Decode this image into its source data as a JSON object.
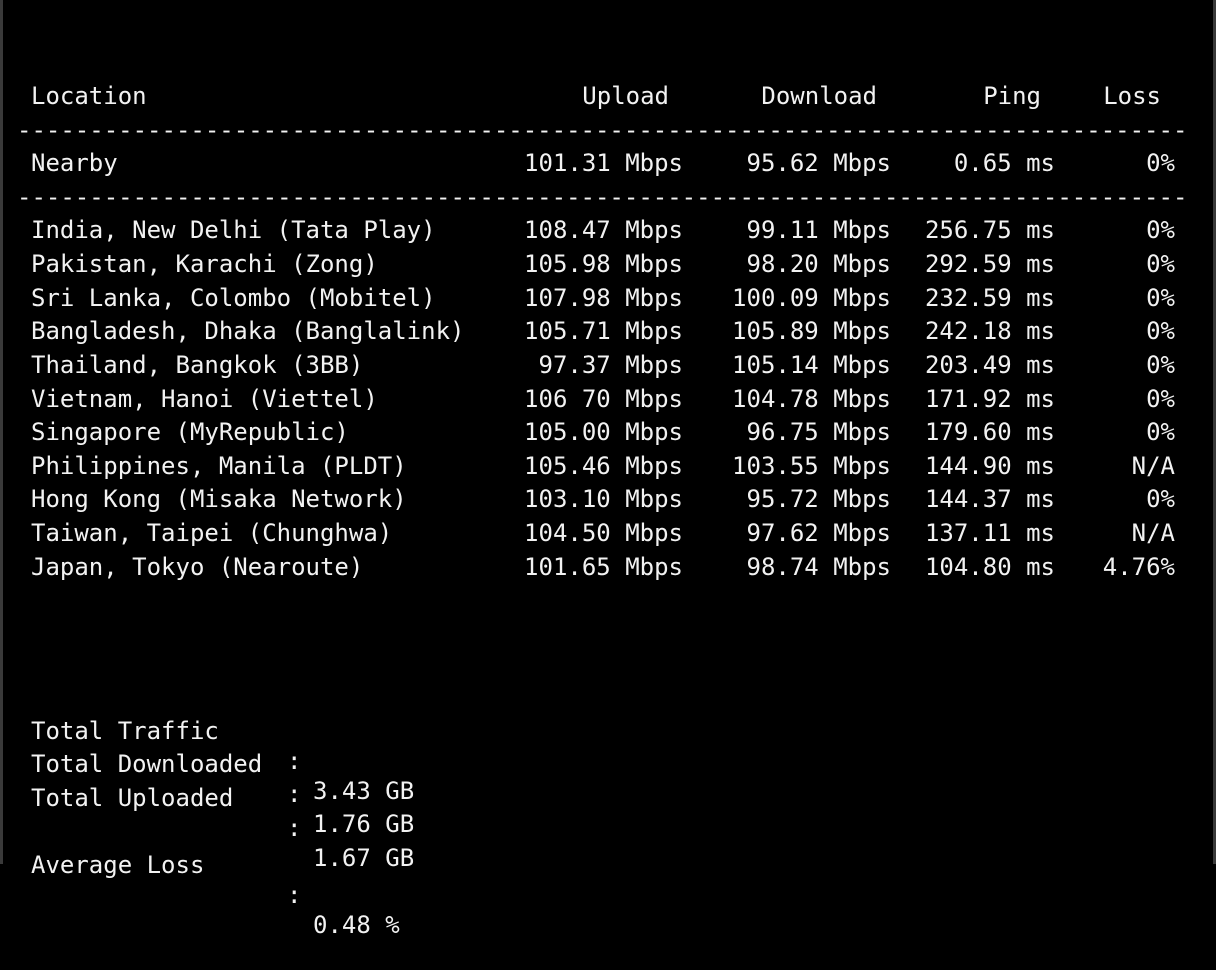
{
  "header": {
    "location": "Location",
    "upload": "Upload",
    "download": "Download",
    "ping": "Ping",
    "loss": "Loss"
  },
  "separator": "----------------------------------------------------------------------------------------------------------------",
  "nearby": {
    "location": "Nearby",
    "upload": "101.31 Mbps",
    "download": "95.62 Mbps",
    "ping": "0.65 ms",
    "loss": "0%"
  },
  "servers": [
    {
      "location": "India, New Delhi (Tata Play)",
      "upload": "108.47 Mbps",
      "download": "99.11 Mbps",
      "ping": "256.75 ms",
      "loss": "0%"
    },
    {
      "location": "Pakistan, Karachi (Zong)",
      "upload": "105.98 Mbps",
      "download": "98.20 Mbps",
      "ping": "292.59 ms",
      "loss": "0%"
    },
    {
      "location": "Sri Lanka, Colombo (Mobitel)",
      "upload": "107.98 Mbps",
      "download": "100.09 Mbps",
      "ping": "232.59 ms",
      "loss": "0%"
    },
    {
      "location": "Bangladesh, Dhaka (Banglalink)",
      "upload": "105.71 Mbps",
      "download": "105.89 Mbps",
      "ping": "242.18 ms",
      "loss": "0%"
    },
    {
      "location": "Thailand, Bangkok (3BB)",
      "upload": "97.37 Mbps",
      "download": "105.14 Mbps",
      "ping": "203.49 ms",
      "loss": "0%"
    },
    {
      "location": "Vietnam, Hanoi (Viettel)",
      "upload": "106 70 Mbps",
      "download": "104.78 Mbps",
      "ping": "171.92 ms",
      "loss": "0%"
    },
    {
      "location": "Singapore (MyRepublic)",
      "upload": "105.00 Mbps",
      "download": "96.75 Mbps",
      "ping": "179.60 ms",
      "loss": "0%"
    },
    {
      "location": "Philippines, Manila (PLDT)",
      "upload": "105.46 Mbps",
      "download": "103.55 Mbps",
      "ping": "144.90 ms",
      "loss": "N/A"
    },
    {
      "location": "Hong Kong (Misaka Network)",
      "upload": "103.10 Mbps",
      "download": "95.72 Mbps",
      "ping": "144.37 ms",
      "loss": "0%"
    },
    {
      "location": "Taiwan, Taipei (Chunghwa)",
      "upload": "104.50 Mbps",
      "download": "97.62 Mbps",
      "ping": "137.11 ms",
      "loss": "N/A"
    },
    {
      "location": "Japan, Tokyo (Nearoute)",
      "upload": "101.65 Mbps",
      "download": "98.74 Mbps",
      "ping": "104.80 ms",
      "loss": "4.76%"
    }
  ],
  "summary": {
    "total_traffic": {
      "label": "Total Traffic",
      "value": "3.43 GB"
    },
    "total_downloaded": {
      "label": "Total Downloaded",
      "value": "1.76 GB"
    },
    "total_uploaded": {
      "label": "Total Uploaded",
      "value": "1.67 GB"
    },
    "average_loss": {
      "label": "Average Loss",
      "value": "0.48 %"
    },
    "colon": ":"
  },
  "colors": {
    "background": "#000000",
    "text": "#f2f2f2"
  }
}
